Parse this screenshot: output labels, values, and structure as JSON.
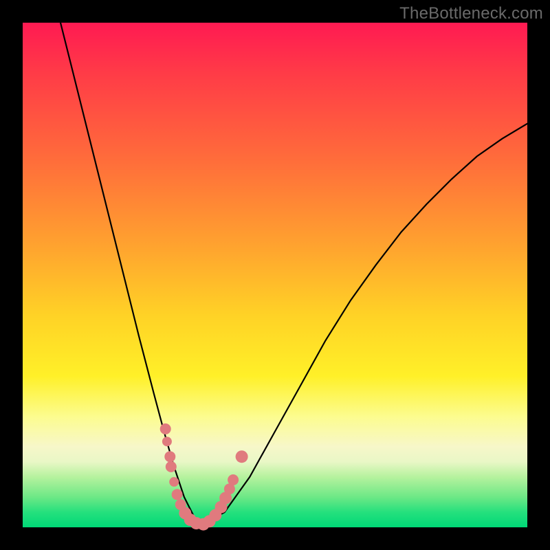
{
  "watermark": "TheBottleneck.com",
  "colors": {
    "gradient_top": "#ff1a52",
    "gradient_mid": "#ffd226",
    "gradient_bottom": "#00d877",
    "curve": "#000000",
    "marker": "#e07a7e",
    "background": "#000000"
  },
  "chart_data": {
    "type": "line",
    "title": "",
    "xlabel": "",
    "ylabel": "",
    "xlim": [
      0,
      100
    ],
    "ylim": [
      0,
      100
    ],
    "grid": false,
    "legend": false,
    "series": [
      {
        "name": "bottleneck-curve",
        "x": [
          7.5,
          10,
          15,
          20,
          23,
          26,
          28,
          30,
          32,
          34,
          35.5,
          40,
          45,
          50,
          55,
          60,
          65,
          70,
          75,
          80,
          85,
          90,
          95,
          100
        ],
        "y": [
          100,
          90,
          70,
          50,
          38,
          26.5,
          19,
          12,
          6,
          2,
          0.5,
          3,
          10,
          19,
          28,
          37,
          45,
          52,
          58.5,
          64,
          69,
          73.5,
          77,
          80
        ]
      }
    ],
    "markers": [
      {
        "x": 28.3,
        "y": 19.5,
        "r": 8
      },
      {
        "x": 28.6,
        "y": 17.0,
        "r": 7
      },
      {
        "x": 29.2,
        "y": 14.0,
        "r": 8
      },
      {
        "x": 29.4,
        "y": 12.0,
        "r": 8
      },
      {
        "x": 30.0,
        "y": 9.0,
        "r": 7
      },
      {
        "x": 30.6,
        "y": 6.5,
        "r": 8
      },
      {
        "x": 31.3,
        "y": 4.5,
        "r": 8
      },
      {
        "x": 32.2,
        "y": 2.8,
        "r": 9
      },
      {
        "x": 33.2,
        "y": 1.5,
        "r": 9
      },
      {
        "x": 34.4,
        "y": 0.8,
        "r": 9
      },
      {
        "x": 35.8,
        "y": 0.6,
        "r": 9
      },
      {
        "x": 37.0,
        "y": 1.2,
        "r": 9
      },
      {
        "x": 38.2,
        "y": 2.4,
        "r": 9
      },
      {
        "x": 39.3,
        "y": 4.0,
        "r": 9
      },
      {
        "x": 40.2,
        "y": 5.8,
        "r": 9
      },
      {
        "x": 41.0,
        "y": 7.6,
        "r": 8
      },
      {
        "x": 41.7,
        "y": 9.4,
        "r": 8
      },
      {
        "x": 43.4,
        "y": 14.0,
        "r": 9
      }
    ],
    "annotations": []
  }
}
